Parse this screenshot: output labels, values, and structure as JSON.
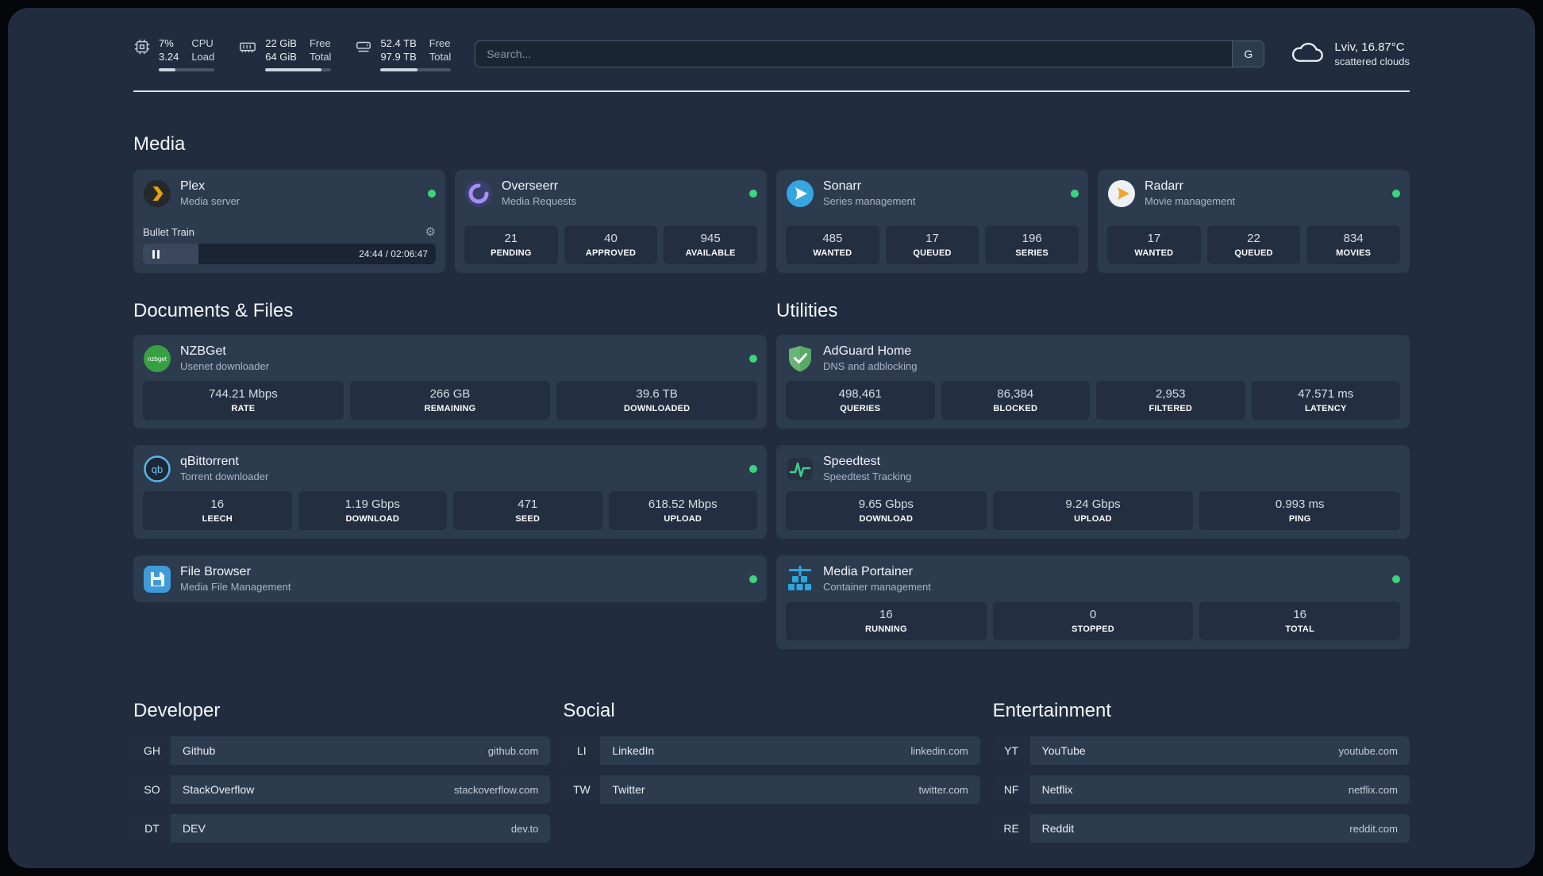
{
  "topbar": {
    "cpu": {
      "value1": "7%",
      "value2": "3.24",
      "label1": "CPU",
      "label2": "Load",
      "bar_percent": 30
    },
    "memory": {
      "value1": "22 GiB",
      "value2": "64 GiB",
      "label1": "Free",
      "label2": "Total",
      "bar_percent": 85
    },
    "disk": {
      "value1": "52.4 TB",
      "value2": "97.9 TB",
      "label1": "Free",
      "label2": "Total",
      "bar_percent": 52
    },
    "search": {
      "placeholder": "Search...",
      "engine": "G"
    },
    "weather": {
      "location": "Lviv, 16.87°C",
      "condition": "scattered clouds"
    }
  },
  "sections": {
    "media": {
      "heading": "Media",
      "plex": {
        "title": "Plex",
        "subtitle": "Media server",
        "player": {
          "track": "Bullet Train",
          "time": "24:44 / 02:06:47",
          "progress_percent": 19
        }
      },
      "overseerr": {
        "title": "Overseerr",
        "subtitle": "Media Requests",
        "stats": [
          {
            "value": "21",
            "label": "PENDING"
          },
          {
            "value": "40",
            "label": "APPROVED"
          },
          {
            "value": "945",
            "label": "AVAILABLE"
          }
        ]
      },
      "sonarr": {
        "title": "Sonarr",
        "subtitle": "Series management",
        "stats": [
          {
            "value": "485",
            "label": "WANTED"
          },
          {
            "value": "17",
            "label": "QUEUED"
          },
          {
            "value": "196",
            "label": "SERIES"
          }
        ]
      },
      "radarr": {
        "title": "Radarr",
        "subtitle": "Movie management",
        "stats": [
          {
            "value": "17",
            "label": "WANTED"
          },
          {
            "value": "22",
            "label": "QUEUED"
          },
          {
            "value": "834",
            "label": "MOVIES"
          }
        ]
      }
    },
    "documents": {
      "heading": "Documents & Files",
      "nzbget": {
        "title": "NZBGet",
        "subtitle": "Usenet downloader",
        "icon_text": "nzbget",
        "stats": [
          {
            "value": "744.21 Mbps",
            "label": "RATE"
          },
          {
            "value": "266 GB",
            "label": "REMAINING"
          },
          {
            "value": "39.6 TB",
            "label": "DOWNLOADED"
          }
        ]
      },
      "qbittorrent": {
        "title": "qBittorrent",
        "subtitle": "Torrent downloader",
        "icon_text": "qb",
        "stats": [
          {
            "value": "16",
            "label": "LEECH"
          },
          {
            "value": "1.19 Gbps",
            "label": "DOWNLOAD"
          },
          {
            "value": "471",
            "label": "SEED"
          },
          {
            "value": "618.52 Mbps",
            "label": "UPLOAD"
          }
        ]
      },
      "filebrowser": {
        "title": "File Browser",
        "subtitle": "Media File Management"
      }
    },
    "utilities": {
      "heading": "Utilities",
      "adguard": {
        "title": "AdGuard Home",
        "subtitle": "DNS and adblocking",
        "stats": [
          {
            "value": "498,461",
            "label": "QUERIES"
          },
          {
            "value": "86,384",
            "label": "BLOCKED"
          },
          {
            "value": "2,953",
            "label": "FILTERED"
          },
          {
            "value": "47.571 ms",
            "label": "LATENCY"
          }
        ]
      },
      "speedtest": {
        "title": "Speedtest",
        "subtitle": "Speedtest Tracking",
        "stats": [
          {
            "value": "9.65 Gbps",
            "label": "DOWNLOAD"
          },
          {
            "value": "9.24 Gbps",
            "label": "UPLOAD"
          },
          {
            "value": "0.993 ms",
            "label": "PING"
          }
        ]
      },
      "portainer": {
        "title": "Media Portainer",
        "subtitle": "Container management",
        "stats": [
          {
            "value": "16",
            "label": "RUNNING"
          },
          {
            "value": "0",
            "label": "STOPPED"
          },
          {
            "value": "16",
            "label": "TOTAL"
          }
        ]
      }
    }
  },
  "bookmarks": {
    "developer": {
      "heading": "Developer",
      "items": [
        {
          "abbr": "GH",
          "name": "Github",
          "url": "github.com"
        },
        {
          "abbr": "SO",
          "name": "StackOverflow",
          "url": "stackoverflow.com"
        },
        {
          "abbr": "DT",
          "name": "DEV",
          "url": "dev.to"
        }
      ]
    },
    "social": {
      "heading": "Social",
      "items": [
        {
          "abbr": "LI",
          "name": "LinkedIn",
          "url": "linkedin.com"
        },
        {
          "abbr": "TW",
          "name": "Twitter",
          "url": "twitter.com"
        }
      ]
    },
    "entertainment": {
      "heading": "Entertainment",
      "items": [
        {
          "abbr": "YT",
          "name": "YouTube",
          "url": "youtube.com"
        },
        {
          "abbr": "NF",
          "name": "Netflix",
          "url": "netflix.com"
        },
        {
          "abbr": "RE",
          "name": "Reddit",
          "url": "reddit.com"
        }
      ]
    }
  },
  "colors": {
    "status_online": "#3bd57c",
    "plex_amber": "#e5a00d",
    "background": "#212d3e",
    "card": "#2d3b4f",
    "tile": "#232f41"
  }
}
